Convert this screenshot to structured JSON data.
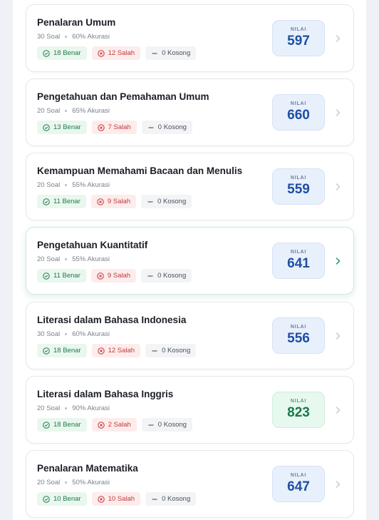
{
  "cards": [
    {
      "title": "Penalaran Umum",
      "soal": "30 Soal",
      "akurasi": "60% Akurasi",
      "benar": "18 Benar",
      "salah": "12 Salah",
      "kosong": "0 Kosong",
      "nilai_label": "NILAI",
      "nilai": "597",
      "color": "blue"
    },
    {
      "title": "Pengetahuan dan Pemahaman Umum",
      "soal": "20 Soal",
      "akurasi": "65% Akurasi",
      "benar": "13 Benar",
      "salah": "7 Salah",
      "kosong": "0 Kosong",
      "nilai_label": "NILAI",
      "nilai": "660",
      "color": "blue"
    },
    {
      "title": "Kemampuan Memahami Bacaan dan Menulis",
      "soal": "20 Soal",
      "akurasi": "55% Akurasi",
      "benar": "11 Benar",
      "salah": "9 Salah",
      "kosong": "0 Kosong",
      "nilai_label": "NILAI",
      "nilai": "559",
      "color": "blue"
    },
    {
      "title": "Pengetahuan Kuantitatif",
      "soal": "20 Soal",
      "akurasi": "55% Akurasi",
      "benar": "11 Benar",
      "salah": "9 Salah",
      "kosong": "0 Kosong",
      "nilai_label": "NILAI",
      "nilai": "641",
      "color": "blue",
      "active": true
    },
    {
      "title": "Literasi dalam Bahasa Indonesia",
      "soal": "30 Soal",
      "akurasi": "60% Akurasi",
      "benar": "18 Benar",
      "salah": "12 Salah",
      "kosong": "0 Kosong",
      "nilai_label": "NILAI",
      "nilai": "556",
      "color": "blue"
    },
    {
      "title": "Literasi dalam Bahasa Inggris",
      "soal": "20 Soal",
      "akurasi": "90% Akurasi",
      "benar": "18 Benar",
      "salah": "2 Salah",
      "kosong": "0 Kosong",
      "nilai_label": "NILAI",
      "nilai": "823",
      "color": "green"
    },
    {
      "title": "Penalaran Matematika",
      "soal": "20 Soal",
      "akurasi": "50% Akurasi",
      "benar": "10 Benar",
      "salah": "10 Salah",
      "kosong": "0 Kosong",
      "nilai_label": "NILAI",
      "nilai": "647",
      "color": "blue"
    }
  ],
  "colors": {
    "ok": "#1f7a4a",
    "bad": "#c23a3a",
    "empty": "#4a505a",
    "chevron": "#c3c8cf",
    "chevron_active": "#0f8a6c"
  },
  "icons": {
    "benar": "check-circle-icon",
    "salah": "x-circle-icon",
    "kosong": "dash-icon",
    "open": "chevron-right-icon"
  }
}
